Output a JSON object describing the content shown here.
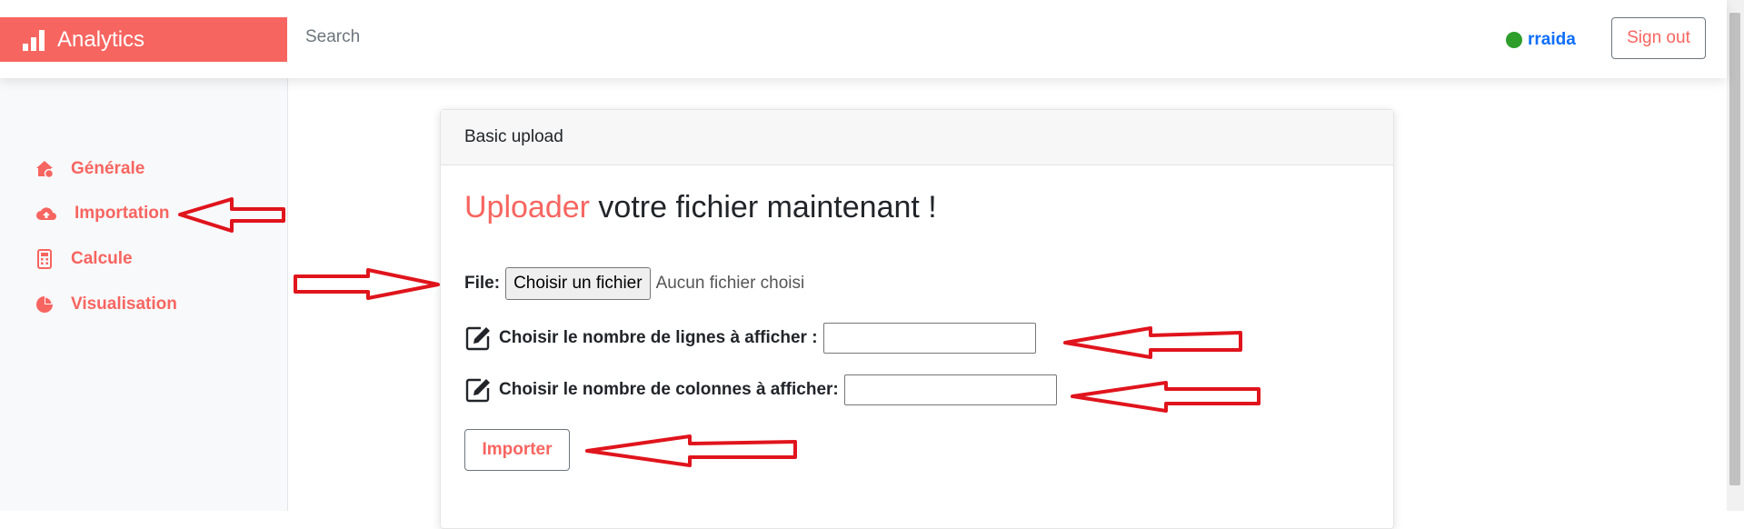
{
  "brand": {
    "name": "Analytics",
    "icon": "bar-chart-icon",
    "color": "#f76560"
  },
  "search": {
    "placeholder": "Search"
  },
  "user": {
    "name": "rraida",
    "status_color": "#2d9e2a"
  },
  "signout_label": "Sign out",
  "sidebar": {
    "items": [
      {
        "label": "Générale",
        "icon": "home-icon"
      },
      {
        "label": "Importation",
        "icon": "cloud-upload-icon"
      },
      {
        "label": "Calcule",
        "icon": "calculator-icon"
      },
      {
        "label": "Visualisation",
        "icon": "pie-chart-icon"
      }
    ]
  },
  "card": {
    "header": "Basic upload",
    "title_accent": "Uploader",
    "title_rest": " votre fichier maintenant !",
    "file_label": "File:",
    "file_button": "Choisir un fichier",
    "file_status": "Aucun fichier choisi",
    "rows_label": "Choisir le nombre de lignes à afficher :",
    "rows_value": "",
    "cols_label": "Choisir le nombre de colonnes à afficher:",
    "cols_value": "",
    "import_button": "Importer"
  },
  "annotation_color": "#e0141c"
}
